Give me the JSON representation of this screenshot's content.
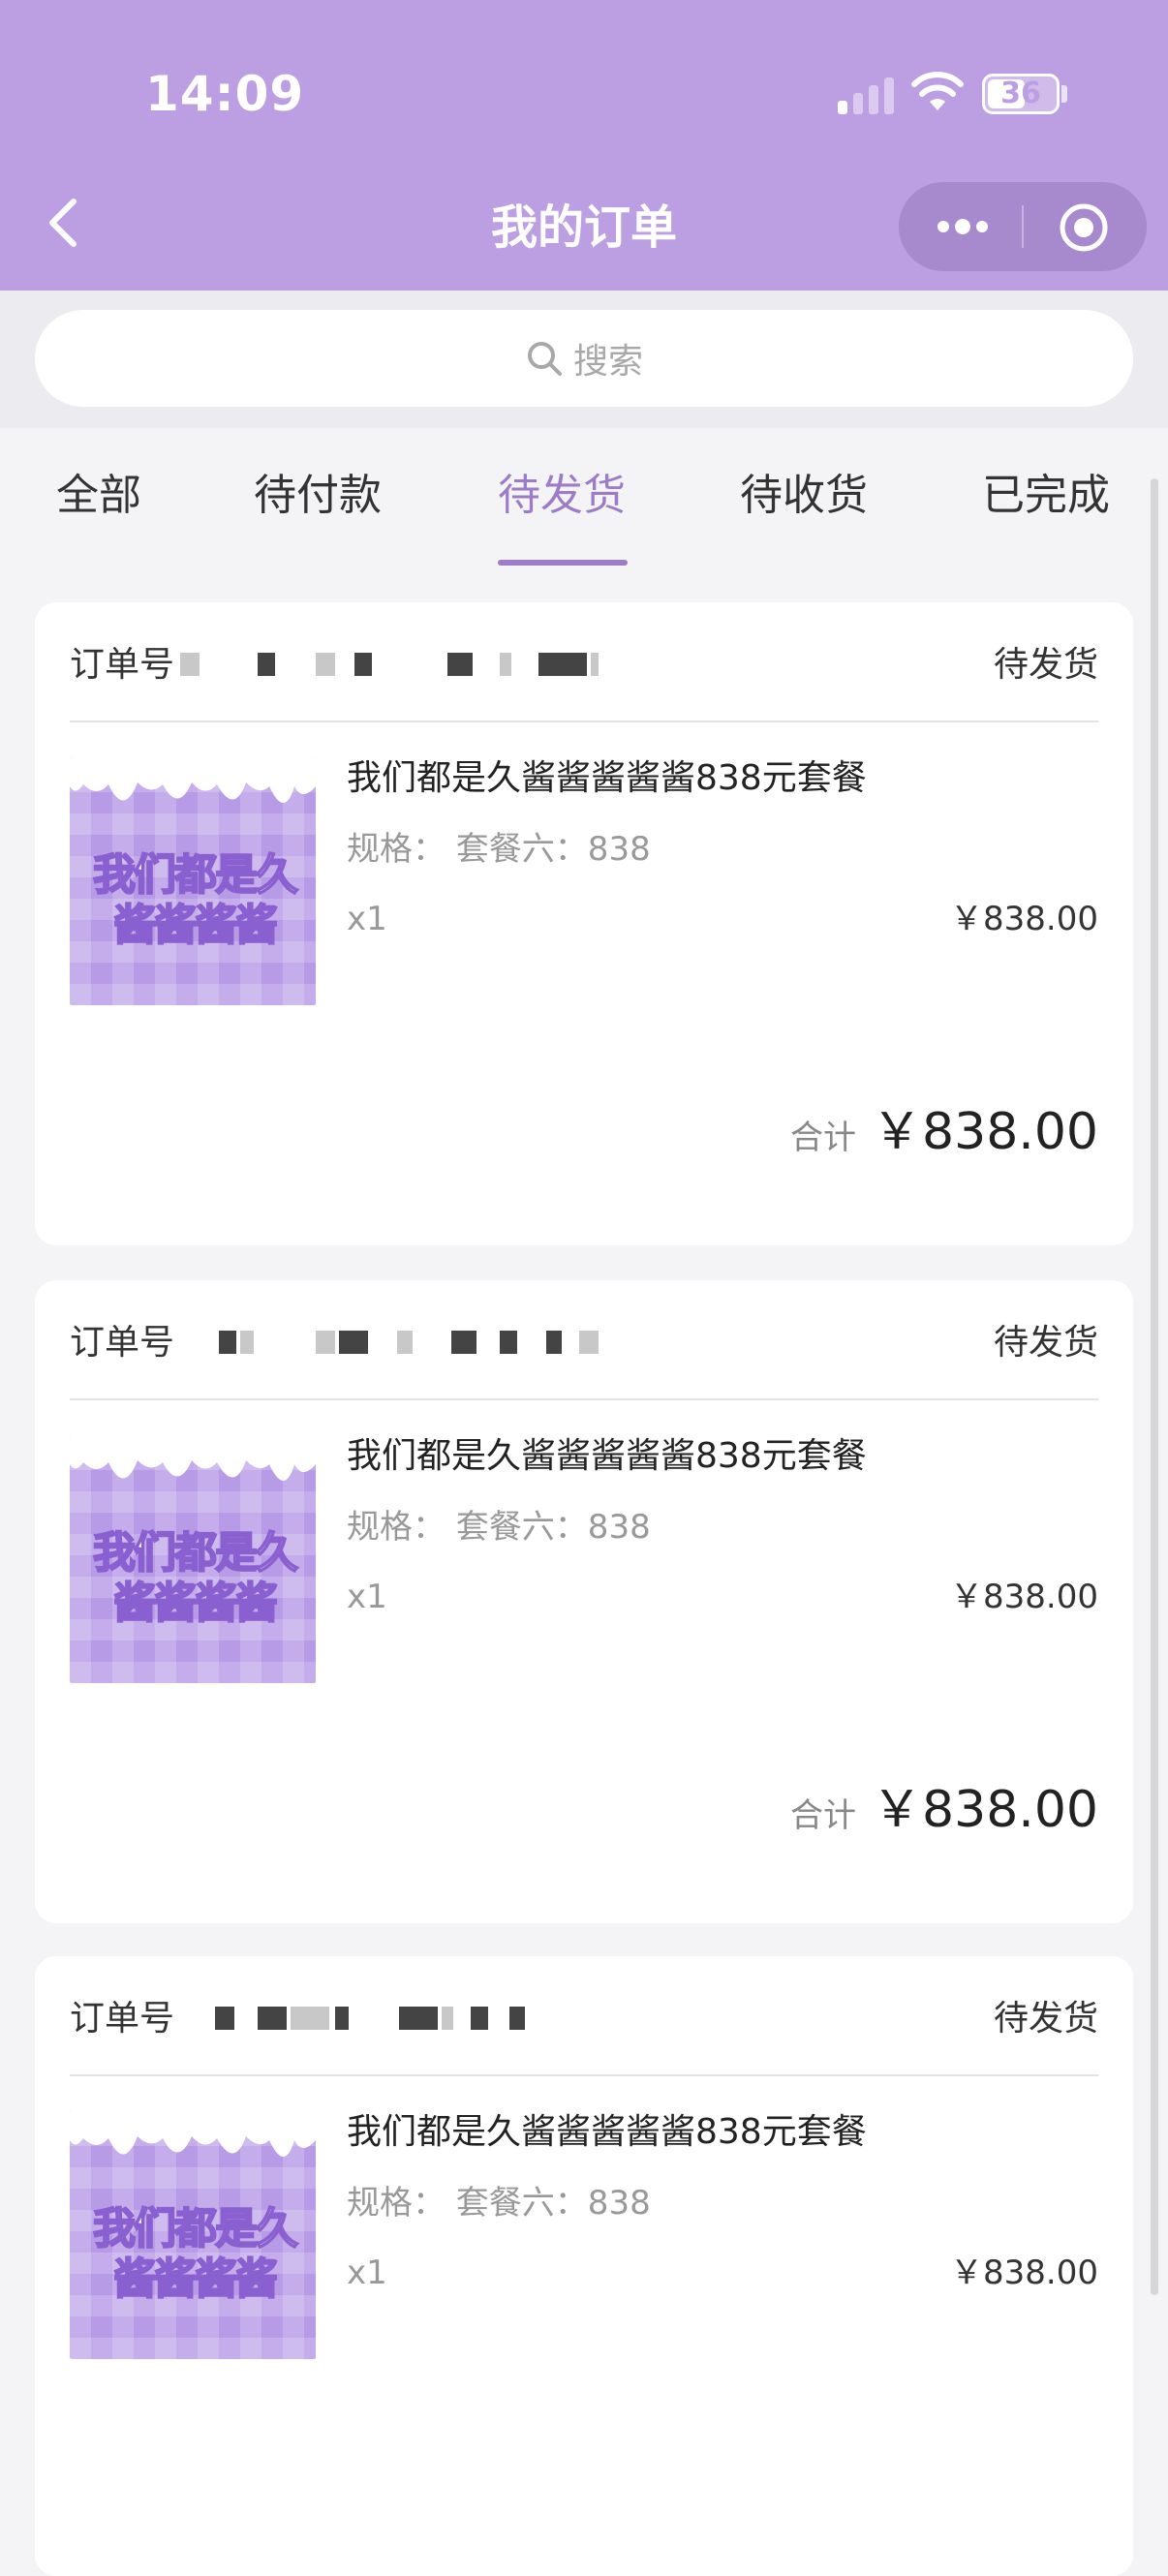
{
  "status_bar": {
    "time": "14:09",
    "battery_level": "36",
    "signal_bars_on": 1
  },
  "nav": {
    "title": "我的订单",
    "back_icon": "chevron-left-icon",
    "more_icon": "more-dots-icon",
    "close_icon": "target-circle-icon"
  },
  "search": {
    "placeholder": "搜索"
  },
  "tabs": [
    {
      "label": "全部"
    },
    {
      "label": "待付款"
    },
    {
      "label": "待发货",
      "active": true
    },
    {
      "label": "待收货"
    },
    {
      "label": "已完成"
    }
  ],
  "orders": [
    {
      "order_label": "订单号",
      "status": "待发货",
      "thumb_text": "我们都是久酱酱酱酱",
      "product_title": "我们都是久酱酱酱酱酱838元套餐",
      "spec": "规格：  套餐六：838",
      "qty": "x1",
      "price": "￥838.00",
      "total_label": "合计",
      "total_amount": "￥838.00"
    },
    {
      "order_label": "订单号",
      "status": "待发货",
      "thumb_text": "我们都是久酱酱酱酱",
      "product_title": "我们都是久酱酱酱酱酱838元套餐",
      "spec": "规格：  套餐六：838",
      "qty": "x1",
      "price": "￥838.00",
      "total_label": "合计",
      "total_amount": "￥838.00"
    },
    {
      "order_label": "订单号",
      "status": "待发货",
      "thumb_text": "我们都是久酱酱酱酱",
      "product_title": "我们都是久酱酱酱酱酱838元套餐",
      "spec": "规格：  套餐六：838",
      "qty": "x1",
      "price": "￥838.00",
      "total_label": "合计",
      "total_amount": "￥838.00"
    }
  ],
  "colors": {
    "header_bg": "#bc9ee2",
    "accent": "#9c7cc9",
    "page_bg": "#f4f4f6"
  }
}
